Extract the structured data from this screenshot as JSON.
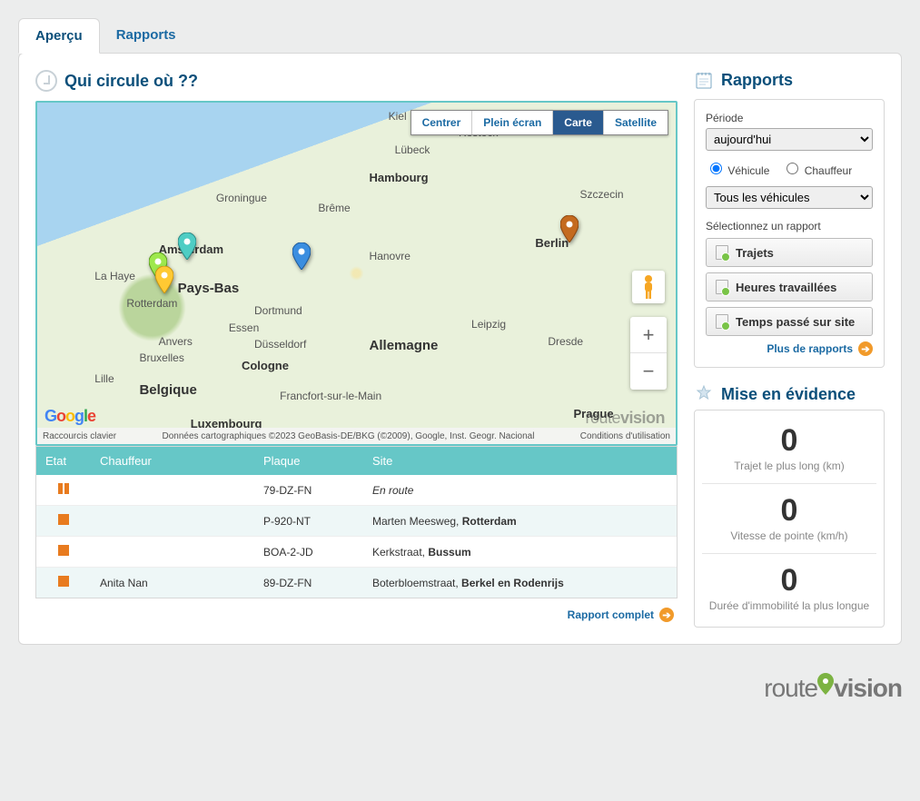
{
  "tabs": {
    "overview": "Aperçu",
    "reports": "Rapports"
  },
  "map_section": {
    "title": "Qui circule où ??",
    "controls": {
      "center": "Centrer",
      "fullscreen": "Plein écran",
      "map": "Carte",
      "satellite": "Satellite"
    },
    "cities": {
      "kiel": "Kiel",
      "lubeck": "Lübeck",
      "rostock": "Rostock",
      "hambourg": "Hambourg",
      "groningue": "Groningue",
      "breme": "Brême",
      "szczecin": "Szczecin",
      "amsterdam": "Amsterdam",
      "hanovre": "Hanovre",
      "berlin": "Berlin",
      "lahaye": "La Haye",
      "paysbas": "Pays-Bas",
      "rotterdam": "Rotterdam",
      "dortmund": "Dortmund",
      "leipzig": "Leipzig",
      "essen": "Essen",
      "dusseldorf": "Düsseldorf",
      "allemagne": "Allemagne",
      "dresde": "Dresde",
      "anvers": "Anvers",
      "bruxelles": "Bruxelles",
      "cologne": "Cologne",
      "lille": "Lille",
      "belgique": "Belgique",
      "francfort": "Francfort-sur-le-Main",
      "prague": "Prague",
      "luxembourg": "Luxembourg"
    },
    "footer": {
      "shortcuts": "Raccourcis clavier",
      "attrib": "Données cartographiques ©2023 GeoBasis-DE/BKG (©2009), Google, Inst. Geogr. Nacional",
      "terms": "Conditions d'utilisation"
    },
    "watermark_a": "route",
    "watermark_b": "vision",
    "full_report": "Rapport complet"
  },
  "table": {
    "headers": {
      "etat": "Etat",
      "chauffeur": "Chauffeur",
      "plaque": "Plaque",
      "site": "Site"
    },
    "rows": [
      {
        "status": "moving",
        "chauffeur": "",
        "plaque": "79-DZ-FN",
        "site_prefix": "",
        "site_bold": "",
        "site_italic": "En route"
      },
      {
        "status": "idle",
        "chauffeur": "",
        "plaque": "P-920-NT",
        "site_prefix": "Marten Meesweg, ",
        "site_bold": "Rotterdam",
        "site_italic": ""
      },
      {
        "status": "idle",
        "chauffeur": "",
        "plaque": "BOA-2-JD",
        "site_prefix": "Kerkstraat, ",
        "site_bold": "Bussum",
        "site_italic": ""
      },
      {
        "status": "idle",
        "chauffeur": "Anita Nan",
        "plaque": "89-DZ-FN",
        "site_prefix": "Boterbloemstraat, ",
        "site_bold": "Berkel en Rodenrijs",
        "site_italic": ""
      }
    ]
  },
  "reports_panel": {
    "title": "Rapports",
    "period_label": "Période",
    "period_value": "aujourd'hui",
    "filter_vehicle": "Véhicule",
    "filter_driver": "Chauffeur",
    "vehicle_select": "Tous les véhicules",
    "select_report": "Sélectionnez un rapport",
    "btn_trips": "Trajets",
    "btn_worked": "Heures travaillées",
    "btn_onsite": "Temps passé sur site",
    "more": "Plus de rapports"
  },
  "highlights": {
    "title": "Mise en évidence",
    "items": [
      {
        "value": "0",
        "label": "Trajet le plus long (km)"
      },
      {
        "value": "0",
        "label": "Vitesse de pointe (km/h)"
      },
      {
        "value": "0",
        "label": "Durée d'immobilité la plus longue"
      }
    ]
  },
  "brand": {
    "a": "route",
    "b": "vision"
  }
}
